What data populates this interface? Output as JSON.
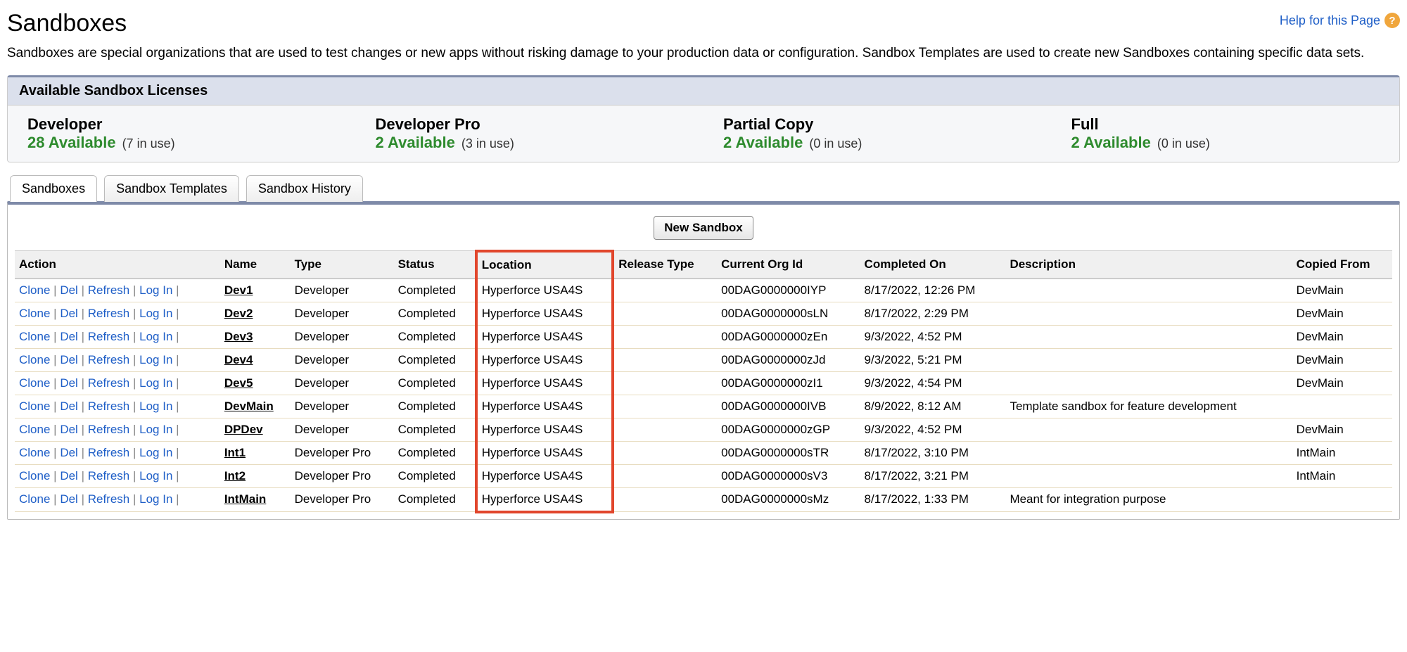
{
  "page": {
    "title": "Sandboxes",
    "help_label": "Help for this Page",
    "intro": "Sandboxes are special organizations that are used to test changes or new apps without risking damage to your production data or configuration. Sandbox Templates are used to create new Sandboxes containing specific data sets."
  },
  "licenses": {
    "header": "Available Sandbox Licenses",
    "items": [
      {
        "title": "Developer",
        "available": "28 Available",
        "use": "(7 in use)"
      },
      {
        "title": "Developer Pro",
        "available": "2 Available",
        "use": "(3 in use)"
      },
      {
        "title": "Partial Copy",
        "available": "2 Available",
        "use": "(0 in use)"
      },
      {
        "title": "Full",
        "available": "2 Available",
        "use": "(0 in use)"
      }
    ]
  },
  "tabs": [
    "Sandboxes",
    "Sandbox Templates",
    "Sandbox History"
  ],
  "buttons": {
    "new": "New Sandbox"
  },
  "actions": {
    "clone": "Clone",
    "del": "Del",
    "refresh": "Refresh",
    "login": "Log In"
  },
  "table": {
    "headers": [
      "Action",
      "Name",
      "Type",
      "Status",
      "Location",
      "Release Type",
      "Current Org Id",
      "Completed On",
      "Description",
      "Copied From"
    ],
    "rows": [
      {
        "name": "Dev1",
        "type": "Developer",
        "status": "Completed",
        "location": "Hyperforce USA4S",
        "release": "",
        "org": "00DAG0000000IYP",
        "completed": "8/17/2022, 12:26 PM",
        "desc": "",
        "copied": "DevMain"
      },
      {
        "name": "Dev2",
        "type": "Developer",
        "status": "Completed",
        "location": "Hyperforce USA4S",
        "release": "",
        "org": "00DAG0000000sLN",
        "completed": "8/17/2022, 2:29 PM",
        "desc": "",
        "copied": "DevMain"
      },
      {
        "name": "Dev3",
        "type": "Developer",
        "status": "Completed",
        "location": "Hyperforce USA4S",
        "release": "",
        "org": "00DAG0000000zEn",
        "completed": "9/3/2022, 4:52 PM",
        "desc": "",
        "copied": "DevMain"
      },
      {
        "name": "Dev4",
        "type": "Developer",
        "status": "Completed",
        "location": "Hyperforce USA4S",
        "release": "",
        "org": "00DAG0000000zJd",
        "completed": "9/3/2022, 5:21 PM",
        "desc": "",
        "copied": "DevMain"
      },
      {
        "name": "Dev5",
        "type": "Developer",
        "status": "Completed",
        "location": "Hyperforce USA4S",
        "release": "",
        "org": "00DAG0000000zI1",
        "completed": "9/3/2022, 4:54 PM",
        "desc": "",
        "copied": "DevMain"
      },
      {
        "name": "DevMain",
        "type": "Developer",
        "status": "Completed",
        "location": "Hyperforce USA4S",
        "release": "",
        "org": "00DAG0000000IVB",
        "completed": "8/9/2022, 8:12 AM",
        "desc": "Template sandbox for feature development",
        "copied": ""
      },
      {
        "name": "DPDev",
        "type": "Developer",
        "status": "Completed",
        "location": "Hyperforce USA4S",
        "release": "",
        "org": "00DAG0000000zGP",
        "completed": "9/3/2022, 4:52 PM",
        "desc": "",
        "copied": "DevMain"
      },
      {
        "name": "Int1",
        "type": "Developer Pro",
        "status": "Completed",
        "location": "Hyperforce USA4S",
        "release": "",
        "org": "00DAG0000000sTR",
        "completed": "8/17/2022, 3:10 PM",
        "desc": "",
        "copied": "IntMain"
      },
      {
        "name": "Int2",
        "type": "Developer Pro",
        "status": "Completed",
        "location": "Hyperforce USA4S",
        "release": "",
        "org": "00DAG0000000sV3",
        "completed": "8/17/2022, 3:21 PM",
        "desc": "",
        "copied": "IntMain"
      },
      {
        "name": "IntMain",
        "type": "Developer Pro",
        "status": "Completed",
        "location": "Hyperforce USA4S",
        "release": "",
        "org": "00DAG0000000sMz",
        "completed": "8/17/2022, 1:33 PM",
        "desc": "Meant for integration purpose",
        "copied": ""
      }
    ]
  }
}
